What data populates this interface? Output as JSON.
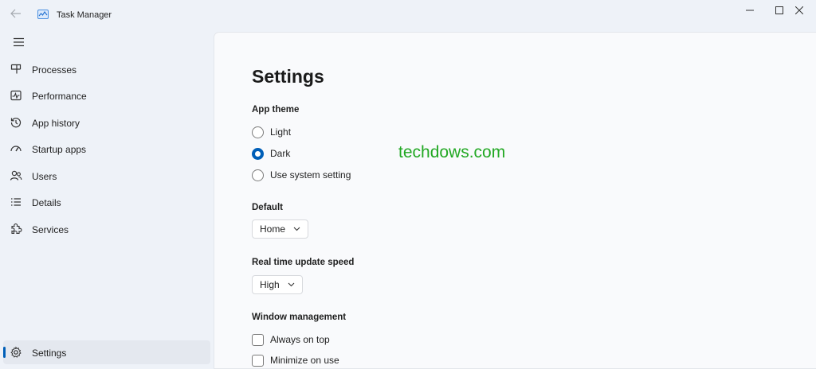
{
  "window": {
    "title": "Task Manager"
  },
  "sidebar": {
    "items": [
      {
        "label": "Processes",
        "icon": "processes-icon"
      },
      {
        "label": "Performance",
        "icon": "performance-icon"
      },
      {
        "label": "App history",
        "icon": "history-icon"
      },
      {
        "label": "Startup apps",
        "icon": "speedometer-icon"
      },
      {
        "label": "Users",
        "icon": "users-icon"
      },
      {
        "label": "Details",
        "icon": "list-icon"
      },
      {
        "label": "Services",
        "icon": "puzzle-icon"
      }
    ],
    "settings": {
      "label": "Settings",
      "icon": "gear-icon",
      "selected": true
    }
  },
  "settings": {
    "title": "Settings",
    "app_theme": {
      "label": "App theme",
      "options": [
        "Light",
        "Dark",
        "Use system setting"
      ],
      "selected": "Dark"
    },
    "default_page": {
      "label": "Default",
      "value": "Home"
    },
    "update_speed": {
      "label": "Real time update speed",
      "value": "High"
    },
    "window_management": {
      "label": "Window management",
      "options": [
        {
          "label": "Always on top",
          "checked": false
        },
        {
          "label": "Minimize on use",
          "checked": false
        }
      ]
    }
  },
  "watermark": "techdows.com",
  "colors": {
    "accent": "#005fb8",
    "watermark": "#22a823"
  }
}
